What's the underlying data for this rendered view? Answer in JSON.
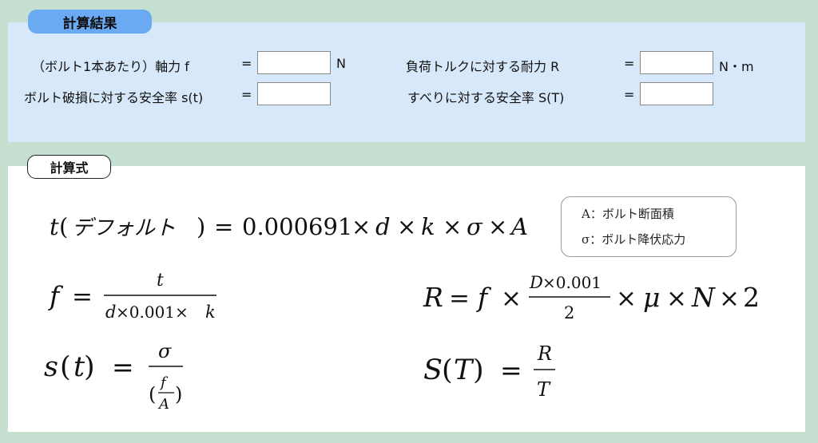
{
  "results": {
    "tab_label": "計算結果",
    "axial_force": {
      "label": "（ボルト1本あたり）軸力 f",
      "eq": "=",
      "value": "",
      "unit": "N"
    },
    "torque_strength": {
      "label": "負荷トルクに対する耐力 R",
      "eq": "=",
      "value": "",
      "unit": "N・m"
    },
    "bolt_break_safety": {
      "label": "ボルト破損に対する安全率 s(t)",
      "eq": "=",
      "value": ""
    },
    "slip_safety": {
      "label": "すべりに対する安全率 S(T)",
      "eq": "=",
      "value": ""
    }
  },
  "formulas": {
    "tab_label": "計算式",
    "f1_lhs_t": "t",
    "f1_lparen": "(",
    "f1_label": "デフォルト",
    "f1_rparen": ")",
    "f1_eq": "=",
    "f1_const": "0.000691",
    "f1_times": "×",
    "f1_d": "d",
    "f1_k": "k",
    "f1_sigma": "σ",
    "f1_A": "A",
    "f2_lhs": "f",
    "f2_eq": "=",
    "f2_num": "t",
    "f2_den_d": "d",
    "f2_den_rest": "×0.001×",
    "f2_den_k": "k",
    "f3_R": "R",
    "f3_eq": "=",
    "f3_f": "f",
    "f3_times": "×",
    "f3_num_D": "D",
    "f3_num_rest": "×0.001",
    "f3_den": "2",
    "f3_mu": "μ",
    "f3_N": "N",
    "f3_two": "2",
    "f4_s": "s",
    "f4_lp": "(",
    "f4_t": "t",
    "f4_rp": ")",
    "f4_eq": "=",
    "f4_num": "σ",
    "f4_f": "f",
    "f4_A": "A",
    "f5_S": "S",
    "f5_lp": "(",
    "f5_T": "T",
    "f5_rp": ")",
    "f5_eq": "=",
    "f5_num": "R",
    "f5_den": "T"
  },
  "legend": {
    "area": "A：ボルト断面積",
    "yield": "σ：ボルト降伏応力"
  }
}
